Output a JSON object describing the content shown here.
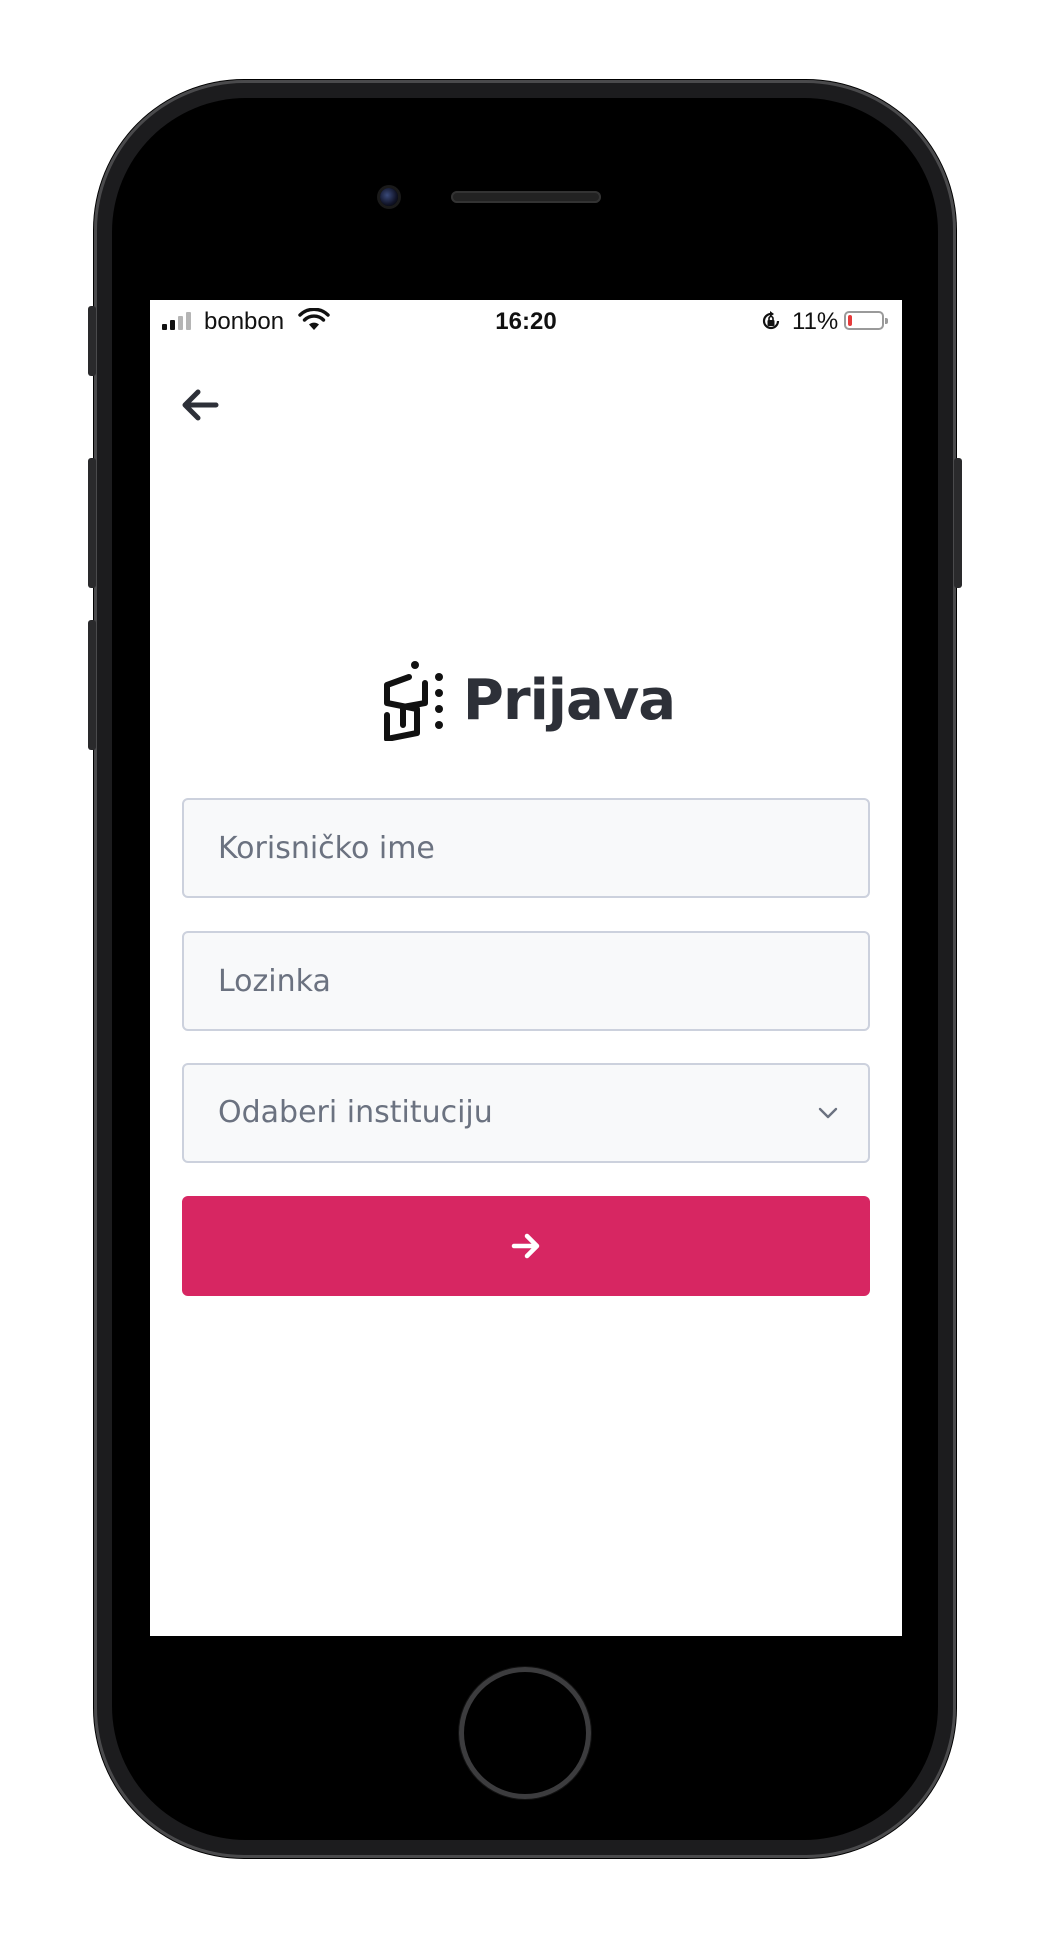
{
  "status_bar": {
    "carrier": "bonbon",
    "time": "16:20",
    "battery_pct": "11%",
    "battery_level": 0.11,
    "battery_color": "#e63b3b"
  },
  "header": {
    "title": "Prijava"
  },
  "form": {
    "username_placeholder": "Korisničko ime",
    "password_placeholder": "Lozinka",
    "institution_placeholder": "Odaberi instituciju"
  },
  "theme": {
    "accent": "#d72662",
    "text_dark": "#2d3038",
    "placeholder": "#6b7280",
    "field_bg": "#f8f9fa",
    "field_border": "#ccd1dd"
  },
  "icons": {
    "back": "arrow-left-icon",
    "submit": "arrow-right-icon",
    "dropdown": "chevron-down-icon",
    "logo": "brand-logo-icon"
  }
}
